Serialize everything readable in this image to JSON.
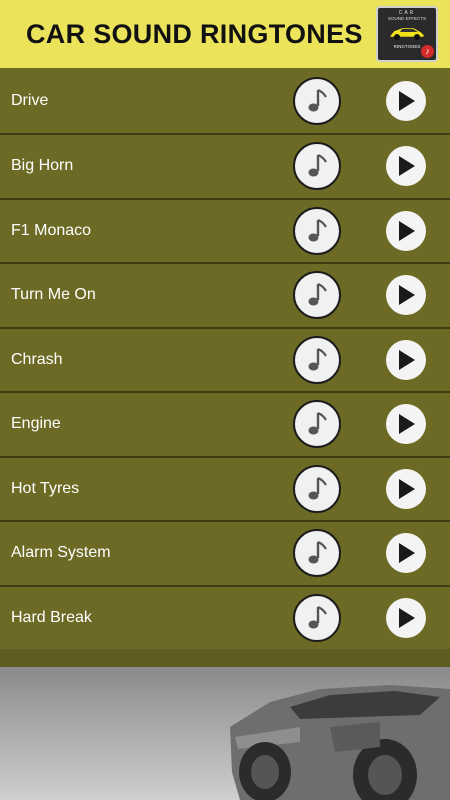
{
  "header": {
    "title": "CAR SOUND RINGTONES",
    "app_icon": {
      "line1": "CAR",
      "line2": "SOUND EFFECTS",
      "line3": "RINGTONES"
    }
  },
  "ringtones": [
    {
      "label": "Drive"
    },
    {
      "label": "Big Horn"
    },
    {
      "label": "F1 Monaco"
    },
    {
      "label": "Turn Me On"
    },
    {
      "label": "Chrash"
    },
    {
      "label": "Engine"
    },
    {
      "label": "Hot Tyres"
    },
    {
      "label": "Alarm System"
    },
    {
      "label": "Hard Break"
    }
  ],
  "icons": {
    "set_ringtone": "music-note-icon",
    "play": "play-icon"
  },
  "colors": {
    "header_bg": "#ebe35a",
    "row_bg": "#6c6a25",
    "row_divider": "#3e3d14"
  }
}
